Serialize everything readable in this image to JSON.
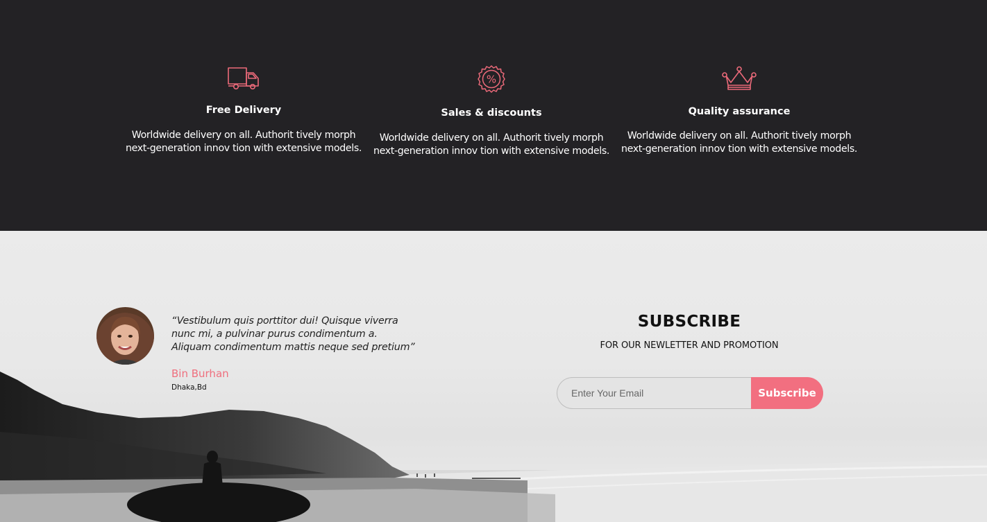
{
  "features": [
    {
      "icon": "truck-icon",
      "title": "Free Delivery",
      "line1": "Worldwide delivery on all. Authorit tively morph",
      "line2": "next-generation innov tion with extensive models."
    },
    {
      "icon": "discount-badge-icon",
      "title": "Sales & discounts",
      "line1": "Worldwide delivery on all. Authorit tively morph",
      "line2": "next-generation innov tion with extensive models."
    },
    {
      "icon": "crown-icon",
      "title": "Quality assurance",
      "line1": "Worldwide delivery on all. Authorit tively morph",
      "line2": "next-generation innov tion with extensive models."
    }
  ],
  "testimonial": {
    "quote_line1": "“Vestibulum quis porttitor dui! Quisque viverra",
    "quote_line2": "nunc mi, a pulvinar purus condimentum a.",
    "quote_line3": "Aliquam condimentum mattis neque sed pretium”",
    "author": "Bin Burhan",
    "location": "Dhaka,Bd"
  },
  "subscribe": {
    "title": "SUBSCRIBE",
    "subtitle": "FOR OUR NEWLETTER AND PROMOTION",
    "email_placeholder": "Enter Your Email",
    "email_value": "",
    "button_label": "Subscribe"
  },
  "colors": {
    "accent": "#f26f80",
    "dark_band": "#232225",
    "icon_pink": "#ec6a7a"
  }
}
